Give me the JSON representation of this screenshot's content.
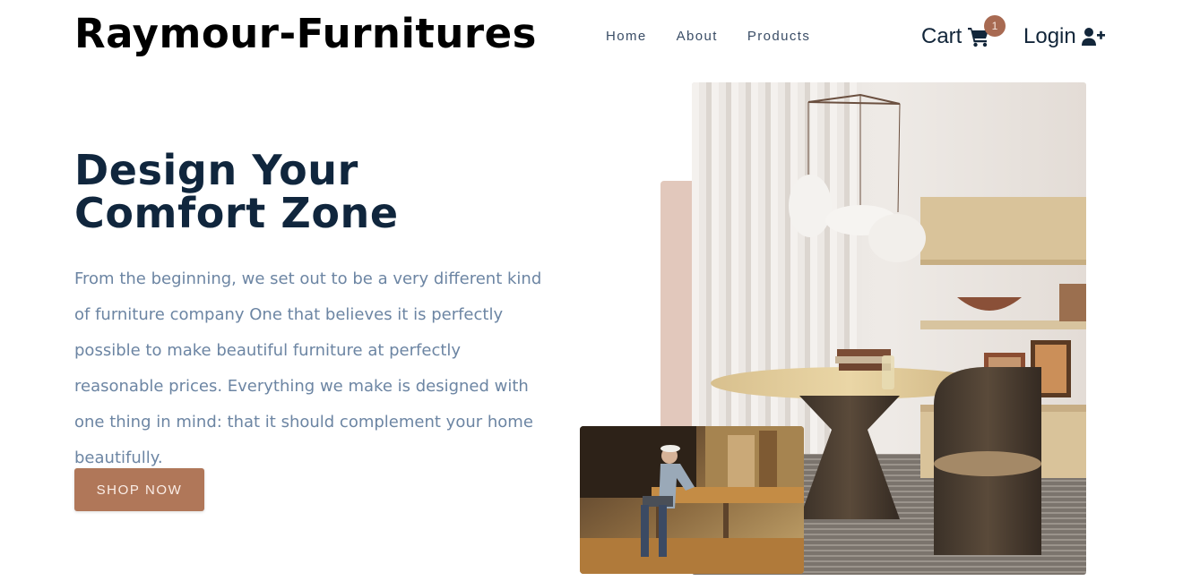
{
  "brand": {
    "name": "Raymour-Furnitures"
  },
  "nav": {
    "links": [
      {
        "label": "Home"
      },
      {
        "label": "About"
      },
      {
        "label": "Products"
      }
    ],
    "cart_label": "Cart",
    "cart_count": "1",
    "login_label": "Login"
  },
  "hero": {
    "title_line1": "Design Your",
    "title_line2": "Comfort Zone",
    "description": "From the beginning, we set out to be a very different kind of furniture company One that believes it is perfectly possible to make beautiful furniture at perfectly reasonable prices. Everything we make is designed with one thing in mind: that it should complement your home beautifully.",
    "cta_label": "SHOP NOW"
  },
  "icons": {
    "cart": "shopping-cart-icon",
    "login": "user-plus-icon"
  },
  "colors": {
    "brand_text": "#000000",
    "heading": "#10263d",
    "body_text": "#6c85a3",
    "accent": "#b07759",
    "badge": "#a86a52",
    "accent_block": "#e2c8bc"
  }
}
